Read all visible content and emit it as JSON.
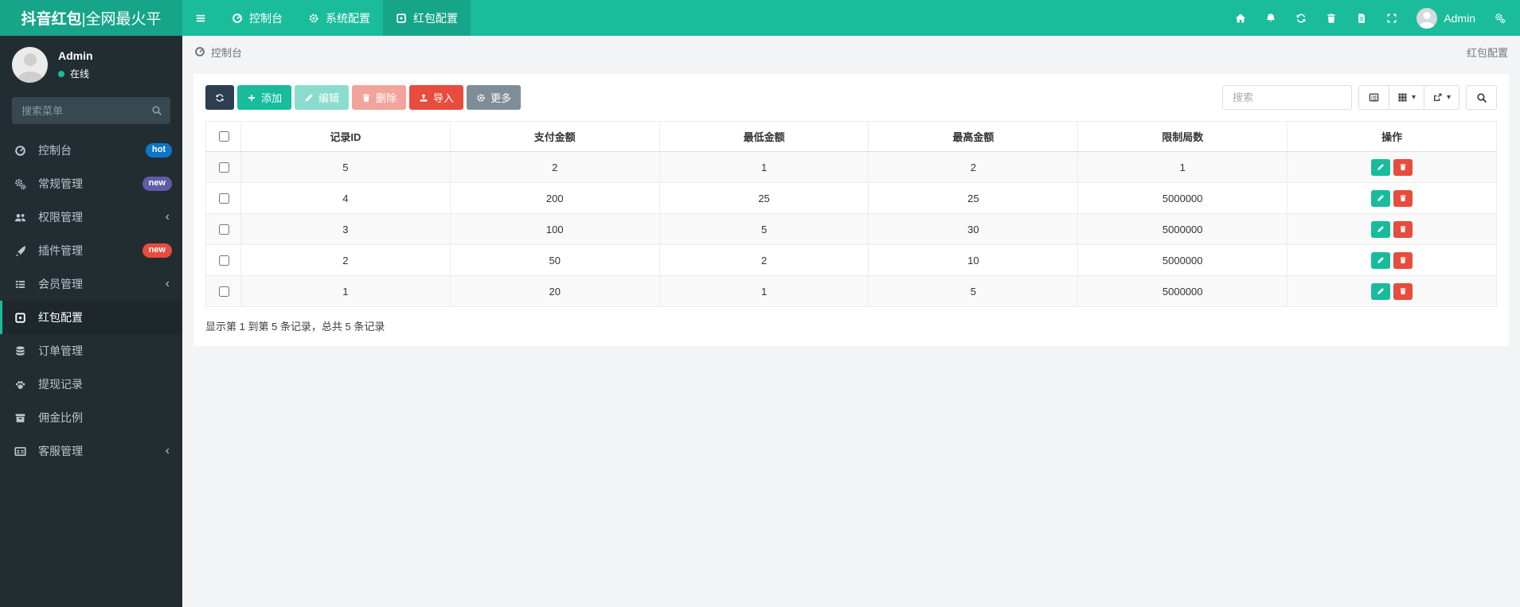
{
  "colors": {
    "accent": "#1abc9c",
    "logo_bg": "#17a589",
    "sidebar_bg": "#222d32",
    "sidebar_active_bg": "#1e282c",
    "btn_dark": "#2c3e50",
    "btn_green": "#18bc9c",
    "btn_red": "#e74c3c",
    "btn_gray": "#7f8d98",
    "stripe": "#f9f9f9"
  },
  "header": {
    "logo_brand": "抖音红包",
    "logo_suffix": "|全网最火平",
    "user_name": "Admin",
    "tabs": [
      {
        "name": "tab-console",
        "label": "控制台",
        "icon": "dashboard-icon",
        "active": false
      },
      {
        "name": "tab-system-config",
        "label": "系统配置",
        "icon": "gear-icon",
        "active": false
      },
      {
        "name": "tab-redpacket-config",
        "label": "红包配置",
        "icon": "box-icon",
        "active": true
      }
    ]
  },
  "sidebar": {
    "user": {
      "name": "Admin",
      "status": "在线"
    },
    "search_placeholder": "搜索菜单",
    "items": [
      {
        "name": "sidebar-item-console",
        "label": "控制台",
        "icon": "dashboard-icon",
        "badge": "hot",
        "badge_color": "#0e76c8",
        "active": false
      },
      {
        "name": "sidebar-item-general",
        "label": "常规管理",
        "icon": "cogs-icon",
        "badge": "new",
        "badge_color": "#605ca8",
        "active": false
      },
      {
        "name": "sidebar-item-auth",
        "label": "权限管理",
        "icon": "users-icon",
        "chevron": true,
        "active": false
      },
      {
        "name": "sidebar-item-addon",
        "label": "插件管理",
        "icon": "rocket-icon",
        "badge": "new",
        "badge_color": "#e74c3c",
        "active": false
      },
      {
        "name": "sidebar-item-member",
        "label": "会员管理",
        "icon": "list-icon",
        "chevron": true,
        "active": false
      },
      {
        "name": "sidebar-item-redpacket",
        "label": "红包配置",
        "icon": "box-icon",
        "active": true
      },
      {
        "name": "sidebar-item-order",
        "label": "订单管理",
        "icon": "database-icon",
        "active": false
      },
      {
        "name": "sidebar-item-withdraw",
        "label": "提现记录",
        "icon": "paw-icon",
        "active": false
      },
      {
        "name": "sidebar-item-commission",
        "label": "佣金比例",
        "icon": "archive-icon",
        "active": false
      },
      {
        "name": "sidebar-item-service",
        "label": "客服管理",
        "icon": "idcard-icon",
        "chevron": true,
        "active": false
      }
    ]
  },
  "breadcrumb": {
    "left": "控制台",
    "right": "红包配置"
  },
  "toolbar": {
    "buttons": [
      {
        "name": "refresh-button",
        "label": "",
        "icon": "refresh-icon",
        "style": "dark",
        "enabled": true
      },
      {
        "name": "add-button",
        "label": "添加",
        "icon": "plus-icon",
        "style": "green",
        "enabled": true
      },
      {
        "name": "edit-button",
        "label": "编辑",
        "icon": "pencil-icon",
        "style": "green",
        "enabled": false
      },
      {
        "name": "delete-button",
        "label": "删除",
        "icon": "trash-icon",
        "style": "red",
        "enabled": false
      },
      {
        "name": "import-button",
        "label": "导入",
        "icon": "upload-icon",
        "style": "red",
        "enabled": true
      },
      {
        "name": "more-button",
        "label": "更多",
        "icon": "gear-icon",
        "style": "gray",
        "enabled": true
      }
    ],
    "search_placeholder": "搜索",
    "view_buttons": [
      {
        "name": "detail-view-button",
        "icon": "listalt-icon",
        "caret": false
      },
      {
        "name": "columns-button",
        "icon": "th-icon",
        "caret": true
      },
      {
        "name": "export-button",
        "icon": "export-icon",
        "caret": true
      }
    ]
  },
  "table": {
    "columns": [
      "记录ID",
      "支付金额",
      "最低金额",
      "最高金额",
      "限制局数",
      "操作"
    ],
    "rows": [
      [
        5,
        2,
        1,
        2,
        1
      ],
      [
        4,
        200,
        25,
        25,
        5000000
      ],
      [
        3,
        100,
        5,
        30,
        5000000
      ],
      [
        2,
        50,
        2,
        10,
        5000000
      ],
      [
        1,
        20,
        1,
        5,
        5000000
      ]
    ]
  },
  "footer": {
    "summary": "显示第 1 到第 5 条记录，总共 5 条记录"
  }
}
